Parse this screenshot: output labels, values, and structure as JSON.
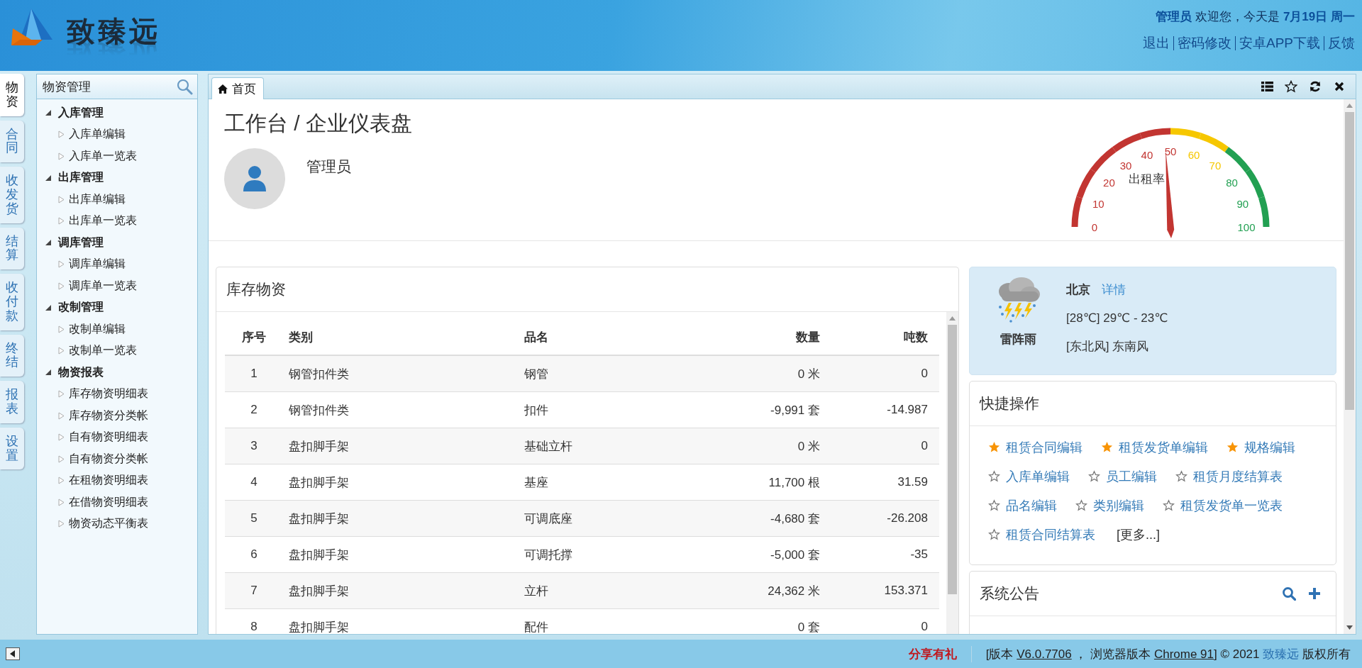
{
  "header": {
    "logo_text": "致臻远",
    "welcome": "**管理员** 欢迎您，今天是 **7月19日 周一**",
    "links": [
      "退出",
      "密码修改",
      "安卓APP下载",
      "反馈"
    ]
  },
  "module_tabs": [
    {
      "label": "物资",
      "selected": true
    },
    {
      "label": "合同",
      "selected": false
    },
    {
      "label": "收发货",
      "selected": false
    },
    {
      "label": "结算",
      "selected": false
    },
    {
      "label": "收付款",
      "selected": false
    },
    {
      "label": "终结",
      "selected": false
    },
    {
      "label": "报表",
      "selected": false
    },
    {
      "label": "设置",
      "selected": false
    }
  ],
  "sidebar": {
    "title": "物资管理",
    "tree": [
      {
        "label": "入库管理",
        "expanded": true,
        "children": [
          {
            "label": "入库单编辑"
          },
          {
            "label": "入库单一览表"
          }
        ]
      },
      {
        "label": "出库管理",
        "expanded": true,
        "children": [
          {
            "label": "出库单编辑"
          },
          {
            "label": "出库单一览表"
          }
        ]
      },
      {
        "label": "调库管理",
        "expanded": true,
        "children": [
          {
            "label": "调库单编辑"
          },
          {
            "label": "调库单一览表"
          }
        ]
      },
      {
        "label": "改制管理",
        "expanded": true,
        "children": [
          {
            "label": "改制单编辑"
          },
          {
            "label": "改制单一览表"
          }
        ]
      },
      {
        "label": "物资报表",
        "expanded": true,
        "children": [
          {
            "label": "库存物资明细表"
          },
          {
            "label": "库存物资分类帐"
          },
          {
            "label": "自有物资明细表"
          },
          {
            "label": "自有物资分类帐"
          },
          {
            "label": "在租物资明细表"
          },
          {
            "label": "在借物资明细表"
          },
          {
            "label": "物资动态平衡表"
          }
        ]
      }
    ]
  },
  "page_tabs": [
    {
      "label": "首页",
      "selected": true
    }
  ],
  "dashboard": {
    "title": "工作台 / 企业仪表盘",
    "user_name": "管理员",
    "gauge": {
      "title": "出租率",
      "level": 0.48,
      "ticks": [
        {
          "label": "0",
          "color": "#c23531"
        },
        {
          "label": "10",
          "color": "#c23531"
        },
        {
          "label": "20",
          "color": "#c23531"
        },
        {
          "label": "30",
          "color": "#c23531"
        },
        {
          "label": "40",
          "color": "#c23531"
        },
        {
          "label": "50",
          "color": "#c23531"
        },
        {
          "label": "60",
          "color": "#f6c700"
        },
        {
          "label": "70",
          "color": "#f6c700"
        },
        {
          "label": "80",
          "color": "#22a052"
        },
        {
          "label": "90",
          "color": "#22a052"
        },
        {
          "label": "100",
          "color": "#22a052"
        }
      ]
    },
    "inventory": {
      "title": "库存物资",
      "columns": [
        "序号",
        "类别",
        "品名",
        "数量",
        "吨数"
      ],
      "rows": [
        [
          "1",
          "钢管扣件类",
          "钢管",
          "0 米",
          "0"
        ],
        [
          "2",
          "钢管扣件类",
          "扣件",
          "-9,991 套",
          "-14.987"
        ],
        [
          "3",
          "盘扣脚手架",
          "基础立杆",
          "0 米",
          "0"
        ],
        [
          "4",
          "盘扣脚手架",
          "基座",
          "11,700 根",
          "31.59"
        ],
        [
          "5",
          "盘扣脚手架",
          "可调底座",
          "-4,680 套",
          "-26.208"
        ],
        [
          "6",
          "盘扣脚手架",
          "可调托撑",
          "-5,000 套",
          "-35"
        ],
        [
          "7",
          "盘扣脚手架",
          "立杆",
          "24,362 米",
          "153.371"
        ],
        [
          "8",
          "盘扣脚手架",
          "配件",
          "0 套",
          "0"
        ]
      ]
    },
    "weather": {
      "city": "北京",
      "details": "详情",
      "temperature": "[28℃] 29℃ - 23℃",
      "condition": "雷阵雨",
      "wind": "[东北风] 东南风"
    },
    "quick_actions": {
      "title": "快捷操作",
      "items": [
        {
          "label": "租赁合同编辑",
          "starred": true
        },
        {
          "label": "租赁发货单编辑",
          "starred": true
        },
        {
          "label": "规格编辑",
          "starred": true
        },
        {
          "label": "入库单编辑",
          "starred": false
        },
        {
          "label": "员工编辑",
          "starred": false
        },
        {
          "label": "租赁月度结算表",
          "starred": false
        },
        {
          "label": "品名编辑",
          "starred": false
        },
        {
          "label": "类别编辑",
          "starred": false
        },
        {
          "label": "租赁发货单一览表",
          "starred": false
        },
        {
          "label": "租赁合同结算表",
          "starred": false
        }
      ],
      "more": "[更多...]"
    },
    "announcements": {
      "title": "系统公告"
    }
  },
  "footer": {
    "share": "分享有礼",
    "parts": [
      {
        "text": "[版本 ",
        "kind": "plain"
      },
      {
        "text": "V6.0.7706",
        "kind": "link"
      },
      {
        "text": " ， 浏览器版本 ",
        "kind": "plain"
      },
      {
        "text": "Chrome 91",
        "kind": "link"
      },
      {
        "text": "] © 2021 ",
        "kind": "plain"
      },
      {
        "text": "致臻远",
        "kind": "brand"
      },
      {
        "text": " 版权所有",
        "kind": "plain"
      }
    ]
  }
}
